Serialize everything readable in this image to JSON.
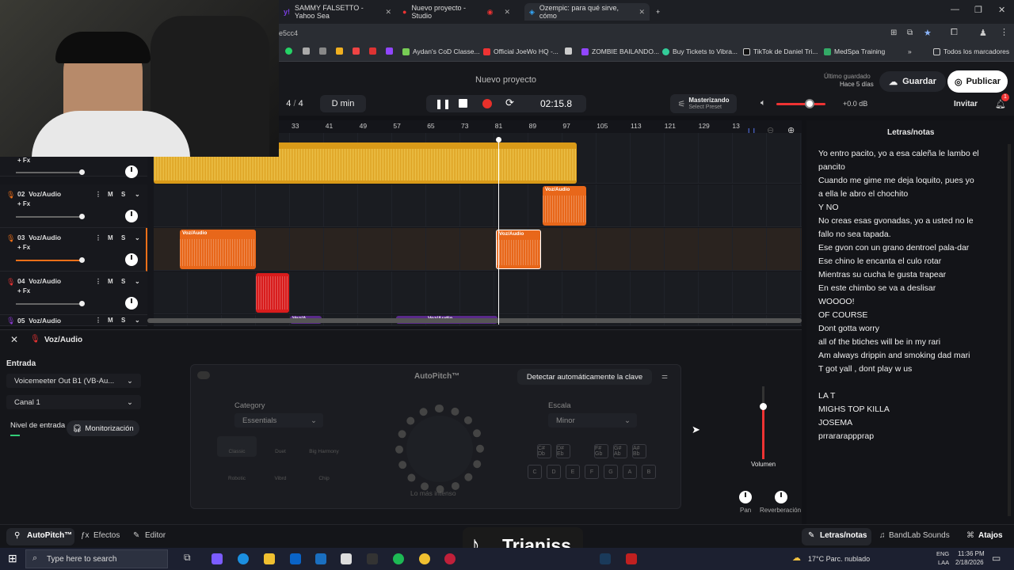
{
  "browser": {
    "tabs": [
      {
        "label": "SAMMY FALSETTO - Yahoo Sea"
      },
      {
        "label": "Nuevo proyecto - Studio"
      },
      {
        "label": "Ozempic: para qué sirve, cómo"
      }
    ],
    "address": "e5cc4",
    "bookmarks": [
      "Aydan's CoD Classe...",
      "Official JoeWo HQ -...",
      "ZOMBIE BAILANDO...",
      "Buy Tickets to Vibra...",
      "TikTok de Daniel Tri...",
      "MedSpa Training"
    ],
    "bookmarks_folder": "Todos los marcadores"
  },
  "header": {
    "project_title": "Nuevo proyecto",
    "saved_label": "Último guardado",
    "saved_time": "Hace 5 días",
    "save_button": "Guardar",
    "publish_button": "Publicar"
  },
  "transport": {
    "time_signature_a": "4",
    "time_signature_sep": "/",
    "time_signature_b": "4",
    "key": "D min",
    "time": "02:15.8",
    "mastering_title": "Masterizando",
    "mastering_sub": "Select Preset",
    "db": "+0.0 dB",
    "invite": "Invitar",
    "notif_count": "1"
  },
  "ruler": [
    "33",
    "41",
    "49",
    "57",
    "65",
    "73",
    "81",
    "89",
    "97",
    "105",
    "113",
    "121",
    "129",
    "13"
  ],
  "tracks": [
    {
      "num": "",
      "name": "",
      "fx": "+ Fx"
    },
    {
      "num": "02",
      "name": "Voz/Audio",
      "fx": "+ Fx"
    },
    {
      "num": "03",
      "name": "Voz/Audio",
      "fx": "+ Fx"
    },
    {
      "num": "04",
      "name": "Voz/Audio",
      "fx": "+ Fx"
    },
    {
      "num": "05",
      "name": "Voz/Audio",
      "fx": ""
    }
  ],
  "clip_label": "Voz/Audio",
  "clip_label_short": "Voz/A...",
  "ms": {
    "m": "M",
    "s": "S"
  },
  "panel": {
    "track_name": "Voz/Audio",
    "input_label": "Entrada",
    "input_device": "Voicemeeter Out B1 (VB-Au...",
    "channel": "Canal 1",
    "level_label": "Nivel de entrada",
    "monitoring": "Monitorización"
  },
  "autopitch": {
    "title": "AutoPitch™",
    "detect_button": "Detectar automáticamente la clave",
    "category_label": "Category",
    "category_value": "Essentials",
    "scale_label": "Escala",
    "scale_value": "Minor",
    "presets": [
      "Classic",
      "Duet",
      "Big Harmony",
      "Robotic",
      "Vibrd",
      "Chip"
    ],
    "chords": [
      "C# Db",
      "D# Eb",
      "F# Gb",
      "G# Ab",
      "A# Bb"
    ],
    "keys": [
      "C",
      "D",
      "E",
      "F",
      "G",
      "A",
      "B"
    ],
    "knob_label": "Lo más intenso"
  },
  "mixer": {
    "volume": "Volumen",
    "pan": "Pan",
    "reverb": "Reverberación"
  },
  "lyrics": {
    "title": "Letras/notas",
    "lines": [
      "Yo entro pacito, yo a esa caleña le lambo el",
      "pancito",
      "Cuando me gime me deja loquito, pues yo",
      "a ella le abro el chochito",
      "Y NO",
      "No creas esas gvonadas, yo a usted no le",
      "fallo no sea tapada.",
      "Ese gvon con un grano dentroel pala-dar",
      "Ese chino le encanta el culo rotar",
      "Mientras su cucha le gusta trapear",
      "En este chimbo se va a deslisar",
      "WOOOO!",
      "OF COURSE",
      "Dont gotta worry",
      "all of the btiches will be in my rari",
      "Am always drippin and smoking dad mari",
      "T got yall , dont play w us",
      "",
      "LA T",
      "MIGHS TOP KILLA",
      "JOSEMA",
      "prrararappprap"
    ]
  },
  "footer": {
    "autopitch": "AutoPitch™",
    "effects": "Efectos",
    "editor": "Editor",
    "lyrics": "Letras/notas",
    "sounds": "BandLab Sounds",
    "shortcuts": "Atajos"
  },
  "watermark": "Trianiss",
  "taskbar": {
    "search": "Type here to search",
    "weather": "17°C  Parc. nublado",
    "lang1": "ENG",
    "lang2": "LAA",
    "time": "11:36 PM",
    "date": "2/18/2026"
  },
  "colors": {
    "track1": "#f0b020",
    "orange": "#f07018",
    "red": "#e02020",
    "purple": "#8a3ad0",
    "record": "#e8302a",
    "accent_red": "#ff3030"
  }
}
